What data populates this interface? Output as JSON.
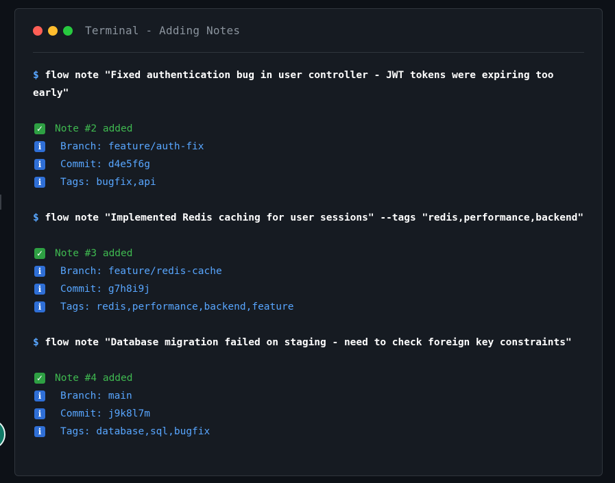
{
  "window": {
    "title": "Terminal - Adding Notes"
  },
  "prompt": "$",
  "blocks": [
    {
      "command": "flow note \"Fixed authentication bug in user controller - JWT tokens were expiring too early\"",
      "note": "Note #2 added",
      "branch": "Branch: feature/auth-fix",
      "commit": "Commit: d4e5f6g",
      "tags": "Tags: bugfix,api"
    },
    {
      "command": "flow note \"Implemented Redis caching for user sessions\" --tags \"redis,performance,backend\"",
      "note": "Note #3 added",
      "branch": "Branch: feature/redis-cache",
      "commit": "Commit: g7h8i9j",
      "tags": "Tags: redis,performance,backend,feature"
    },
    {
      "command": "flow note \"Database migration failed on staging - need to check foreign key constraints\"",
      "note": "Note #4 added",
      "branch": "Branch: main",
      "commit": "Commit: j9k8l7m",
      "tags": "Tags: database,sql,bugfix"
    }
  ],
  "icons": {
    "success": "check-icon",
    "info": "info-icon"
  },
  "colors": {
    "background": "#161b22",
    "prompt": "#58a6ff",
    "success": "#3fb950",
    "info": "#58a6ff"
  }
}
